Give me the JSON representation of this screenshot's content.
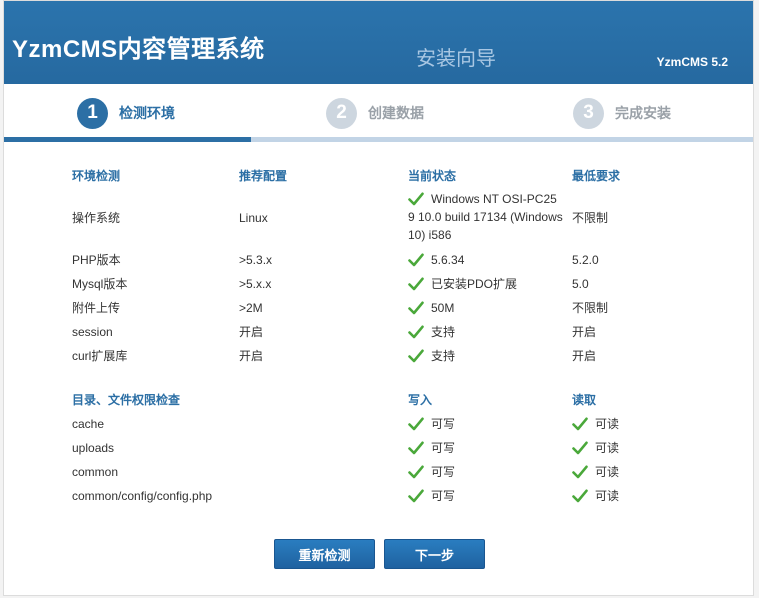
{
  "header": {
    "logo": "YzmCMS内容管理系统",
    "subtitle": "安装向导",
    "version": "YzmCMS 5.2"
  },
  "steps": [
    {
      "num": "1",
      "label": "检测环境",
      "active": true
    },
    {
      "num": "2",
      "label": "创建数据",
      "active": false
    },
    {
      "num": "3",
      "label": "完成安装",
      "active": false
    }
  ],
  "progress": {
    "completed_steps": 1,
    "total_steps": 3
  },
  "env": {
    "headers": [
      "环境检测",
      "推荐配置",
      "当前状态",
      "最低要求"
    ],
    "os": {
      "name": "操作系统",
      "recommended": "Linux",
      "status_line1": "Windows NT OSI-PC25",
      "status_rest": "9 10.0 build 17134 (Windows 10) i586",
      "minimum": "不限制"
    },
    "rows": [
      {
        "name": "PHP版本",
        "recommended": ">5.3.x",
        "status": "5.6.34",
        "minimum": "5.2.0"
      },
      {
        "name": "Mysql版本",
        "recommended": ">5.x.x",
        "status": "已安装PDO扩展",
        "minimum": "5.0"
      },
      {
        "name": "附件上传",
        "recommended": ">2M",
        "status": "50M",
        "minimum": "不限制"
      },
      {
        "name": "session",
        "recommended": "开启",
        "status": "支持",
        "minimum": "开启"
      },
      {
        "name": "curl扩展库",
        "recommended": "开启",
        "status": "支持",
        "minimum": "开启"
      }
    ]
  },
  "perm": {
    "headers": [
      "目录、文件权限检查",
      "写入",
      "读取"
    ],
    "rows": [
      {
        "path": "cache",
        "write": "可写",
        "read": "可读"
      },
      {
        "path": "uploads",
        "write": "可写",
        "read": "可读"
      },
      {
        "path": "common",
        "write": "可写",
        "read": "可读"
      },
      {
        "path": "common/config/config.php",
        "write": "可写",
        "read": "可读"
      }
    ]
  },
  "buttons": {
    "recheck": "重新检测",
    "next": "下一步"
  },
  "colors": {
    "primary": "#2c6fa5",
    "check": "#4aa83a"
  },
  "icons": {
    "status_ok": "check-icon"
  }
}
